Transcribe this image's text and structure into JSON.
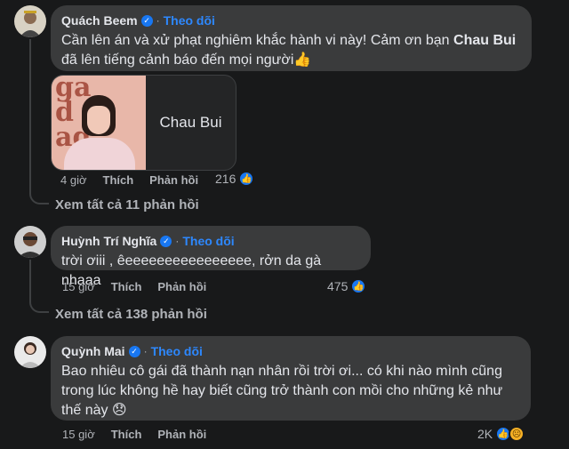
{
  "comments": [
    {
      "name": "Quách Beem",
      "follow": "Theo dõi",
      "text_line1_a": "Cần lên án và xử phạt nghiêm khắc hành vi này! Cảm ơn bạn ",
      "text_line1_b": "Chau Bui",
      "text_line2": "đã lên tiếng cảnh báo đến mọi người👍",
      "tag_name": "Chau Bui",
      "time": "4 giờ",
      "like": "Thích",
      "reply": "Phản hồi",
      "reactions": "216",
      "view_replies": "Xem tất cả 11 phản hồi"
    },
    {
      "name": "Huỳnh Trí Nghĩa",
      "follow": "Theo dõi",
      "text": "trời ơiii , êeeeeeeeeeeeeeeee, rởn da gà nhaaa",
      "time": "15 giờ",
      "like": "Thích",
      "reply": "Phản hồi",
      "reactions": "475",
      "view_replies": "Xem tất cả 138 phản hồi"
    },
    {
      "name": "Quỳnh Mai",
      "follow": "Theo dõi",
      "text_line1": "Bao nhiêu cô gái đã thành nạn nhân rồi trời ơi... có khi nào mình cũng",
      "text_line2": "trong lúc không hề hay biết cũng trở thành con mồi cho những kẻ như",
      "text_line3": "thế này 😞",
      "time": "15 giờ",
      "like": "Thích",
      "reply": "Phản hồi",
      "reactions": "2K"
    }
  ],
  "icons": {
    "verified": "verified-badge-icon",
    "like": "like-reaction-icon",
    "sad": "sad-reaction-icon"
  },
  "colors": {
    "background": "#18191a",
    "bubble": "#3a3b3c",
    "link": "#2d88ff",
    "like": "#1877f2"
  }
}
